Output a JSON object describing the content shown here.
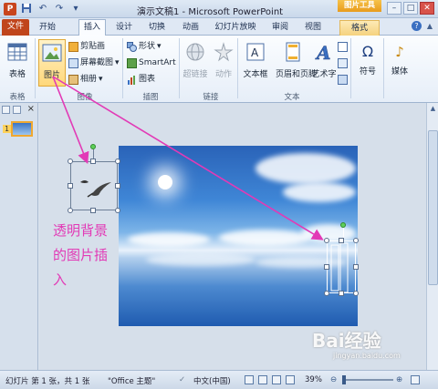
{
  "titlebar": {
    "title": "演示文稿1 - Microsoft PowerPoint",
    "context_tab_label": "图片工具",
    "app_icon_letter": "P",
    "window_controls": [
      "–",
      "□",
      "✕"
    ]
  },
  "tabs": [
    {
      "label": "文件",
      "kind": "file"
    },
    {
      "label": "开始",
      "kind": "normal"
    },
    {
      "label": "插入",
      "kind": "active"
    },
    {
      "label": "设计",
      "kind": "normal"
    },
    {
      "label": "切换",
      "kind": "normal"
    },
    {
      "label": "动画",
      "kind": "normal"
    },
    {
      "label": "幻灯片放映",
      "kind": "normal"
    },
    {
      "label": "审阅",
      "kind": "normal"
    },
    {
      "label": "视图",
      "kind": "normal"
    },
    {
      "label": "格式",
      "kind": "format"
    }
  ],
  "ribbon": {
    "groups": {
      "table": "表格",
      "image": "图像",
      "illustration": "插图",
      "link": "链接",
      "text": "文本"
    },
    "buttons": {
      "table": "表格",
      "picture": "图片",
      "clipart": "剪贴画",
      "screenshot": "屏幕截图",
      "album": "相册",
      "shapes": "形状",
      "smartart": "SmartArt",
      "chart": "图表",
      "hyperlink": "超链接",
      "action": "动作",
      "textbox": "文本框",
      "header_footer": "页眉和页脚",
      "wordart": "艺术字",
      "symbol": "符号",
      "media": "媒体"
    }
  },
  "annotation": {
    "text": "透明背景的图片插入"
  },
  "slide": {
    "number": "1"
  },
  "watermark": {
    "brand": "Bai经验",
    "url": "jingyan.baidu.com"
  },
  "statusbar": {
    "slide_info": "幻灯片 第 1 张，共 1 张",
    "theme": "\"Office 主题\"",
    "language": "中文(中国)",
    "zoom": "39%",
    "zoom_minus": "⊖",
    "zoom_plus": "⊕"
  },
  "colors": {
    "file_tab": "#c0451c",
    "annotation": "#e23ab6",
    "context_tab": "#f0b030"
  }
}
